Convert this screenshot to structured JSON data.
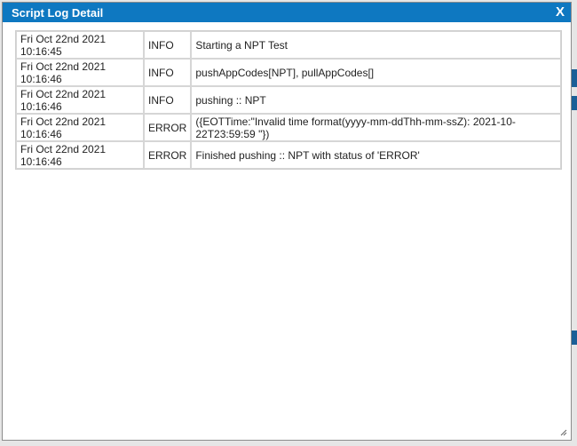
{
  "dialog": {
    "title": "Script Log Detail",
    "close_label": "X"
  },
  "log": {
    "rows": [
      {
        "time": "Fri Oct 22nd 2021 10:16:45",
        "level": "INFO",
        "message": "Starting a NPT Test"
      },
      {
        "time": "Fri Oct 22nd 2021 10:16:46",
        "level": "INFO",
        "message": "pushAppCodes[NPT], pullAppCodes[]"
      },
      {
        "time": "Fri Oct 22nd 2021 10:16:46",
        "level": "INFO",
        "message": "pushing :: NPT"
      },
      {
        "time": "Fri Oct 22nd 2021 10:16:46",
        "level": "ERROR",
        "message": "({EOTTime:\"Invalid time format(yyyy-mm-ddThh-mm-ssZ): 2021-10-22T23:59:59 \"})"
      },
      {
        "time": "Fri Oct 22nd 2021 10:16:46",
        "level": "ERROR",
        "message": "Finished pushing :: NPT with status of 'ERROR'"
      }
    ]
  },
  "colors": {
    "titlebar": "#0e78c1",
    "background": "#e6e6e6"
  }
}
